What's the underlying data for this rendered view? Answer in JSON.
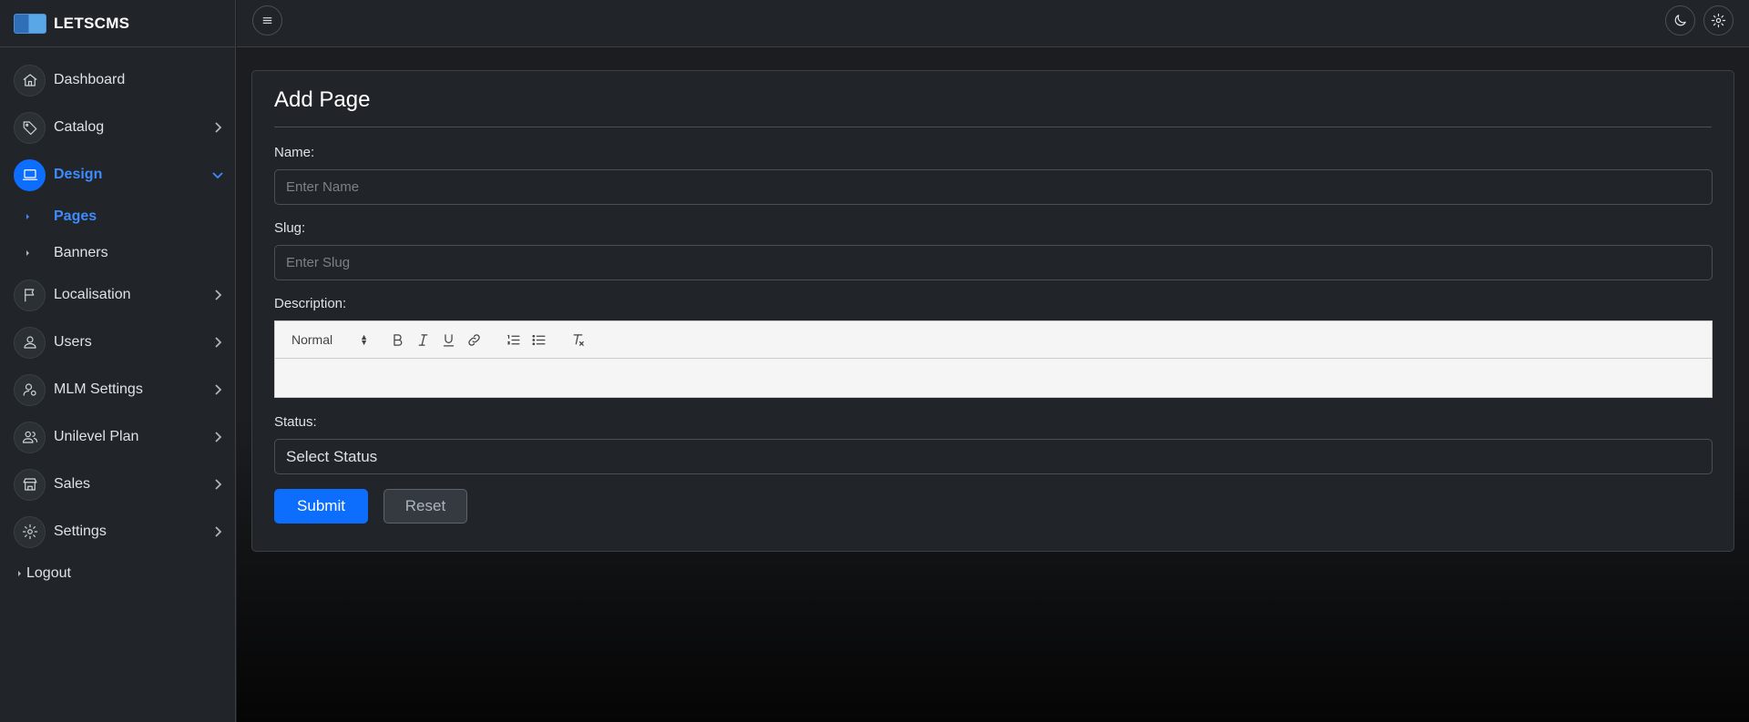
{
  "brand": {
    "name": "LETSCMS"
  },
  "sidebar": {
    "items": [
      {
        "label": "Dashboard",
        "icon": "home-icon",
        "expandable": false
      },
      {
        "label": "Catalog",
        "icon": "tag-icon",
        "expandable": true
      },
      {
        "label": "Design",
        "icon": "laptop-icon",
        "expandable": true,
        "active": true,
        "children": [
          {
            "label": "Pages",
            "active": true
          },
          {
            "label": "Banners"
          }
        ]
      },
      {
        "label": "Localisation",
        "icon": "flag-icon",
        "expandable": true
      },
      {
        "label": "Users",
        "icon": "user-icon",
        "expandable": true
      },
      {
        "label": "MLM Settings",
        "icon": "user-gear-icon",
        "expandable": true
      },
      {
        "label": "Unilevel Plan",
        "icon": "users-icon",
        "expandable": true
      },
      {
        "label": "Sales",
        "icon": "shop-icon",
        "expandable": true
      },
      {
        "label": "Settings",
        "icon": "gear-icon",
        "expandable": true
      }
    ],
    "logout": "Logout"
  },
  "topbar": {
    "menu_icon": "hamburger-icon",
    "theme_icon": "moon-icon",
    "settings_icon": "gear-icon"
  },
  "form": {
    "title": "Add Page",
    "name": {
      "label": "Name:",
      "placeholder": "Enter Name",
      "value": ""
    },
    "slug": {
      "label": "Slug:",
      "placeholder": "Enter Slug",
      "value": ""
    },
    "description": {
      "label": "Description:",
      "format": "Normal",
      "value": ""
    },
    "status": {
      "label": "Status:",
      "selected": "Select Status"
    },
    "submit": "Submit",
    "reset": "Reset"
  },
  "colors": {
    "accent": "#0d6efd",
    "background": "#212529",
    "border": "#495057"
  }
}
